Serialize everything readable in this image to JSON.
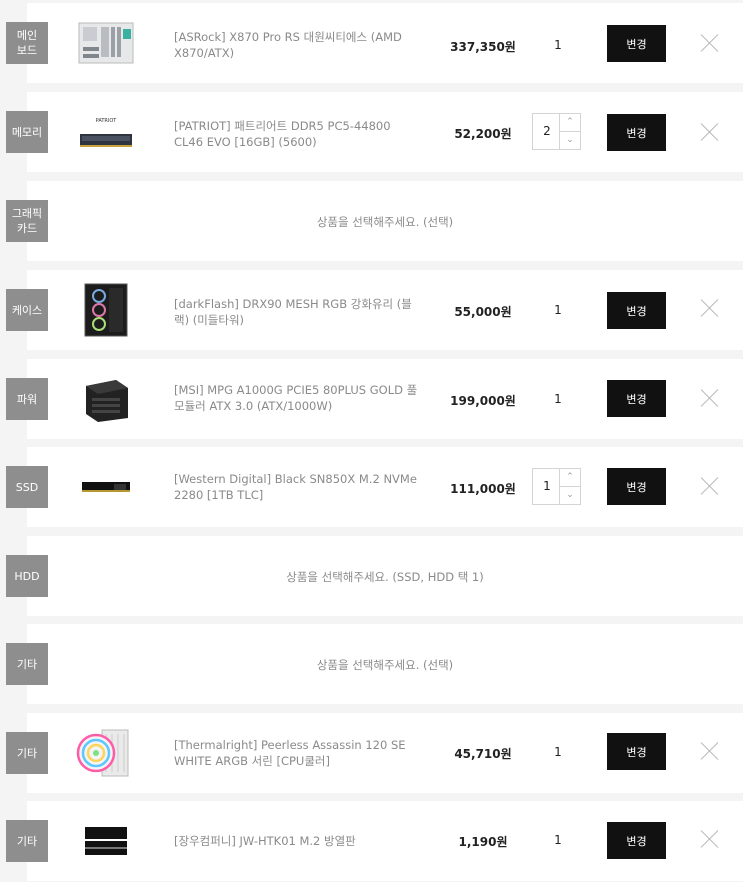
{
  "change_label": "변경",
  "rows": [
    {
      "category": "메인\n보드",
      "name": "[ASRock] X870 Pro RS 대원씨티에스 (AMD X870/ATX)",
      "price": "337,350원",
      "qty": "1",
      "image": "motherboard-image"
    },
    {
      "category": "메모리",
      "name": "[PATRIOT] 패트리어트 DDR5 PC5-44800 CL46 EVO [16GB] (5600)",
      "price": "52,200원",
      "qty": "2",
      "image": "memory-image"
    },
    {
      "category": "그래픽\n카드",
      "empty_text": "상품을 선택해주세요. (선택)"
    },
    {
      "category": "케이스",
      "name": "[darkFlash] DRX90 MESH RGB 강화유리 (블랙) (미들타워)",
      "price": "55,000원",
      "qty": "1",
      "image": "case-image"
    },
    {
      "category": "파워",
      "name": "[MSI] MPG A1000G PCIE5 80PLUS GOLD 풀모듈러 ATX 3.0 (ATX/1000W)",
      "price": "199,000원",
      "qty": "1",
      "image": "psu-image"
    },
    {
      "category": "SSD",
      "name": "[Western Digital] Black SN850X M.2 NVMe 2280 [1TB TLC]",
      "price": "111,000원",
      "qty": "1",
      "image": "ssd-image"
    },
    {
      "category": "HDD",
      "empty_text": "상품을 선택해주세요. (SSD, HDD 택 1)"
    },
    {
      "category": "기타",
      "empty_text": "상품을 선택해주세요. (선택)"
    },
    {
      "category": "기타",
      "name": "[Thermalright] Peerless Assassin 120 SE WHITE ARGB 서린 [CPU쿨러]",
      "price": "45,710원",
      "qty": "1",
      "image": "cooler-image"
    },
    {
      "category": "기타",
      "name": "[장우컴퍼니] JW-HTK01 M.2 방열판",
      "price": "1,190원",
      "qty": "1",
      "image": "heatsink-image"
    }
  ]
}
